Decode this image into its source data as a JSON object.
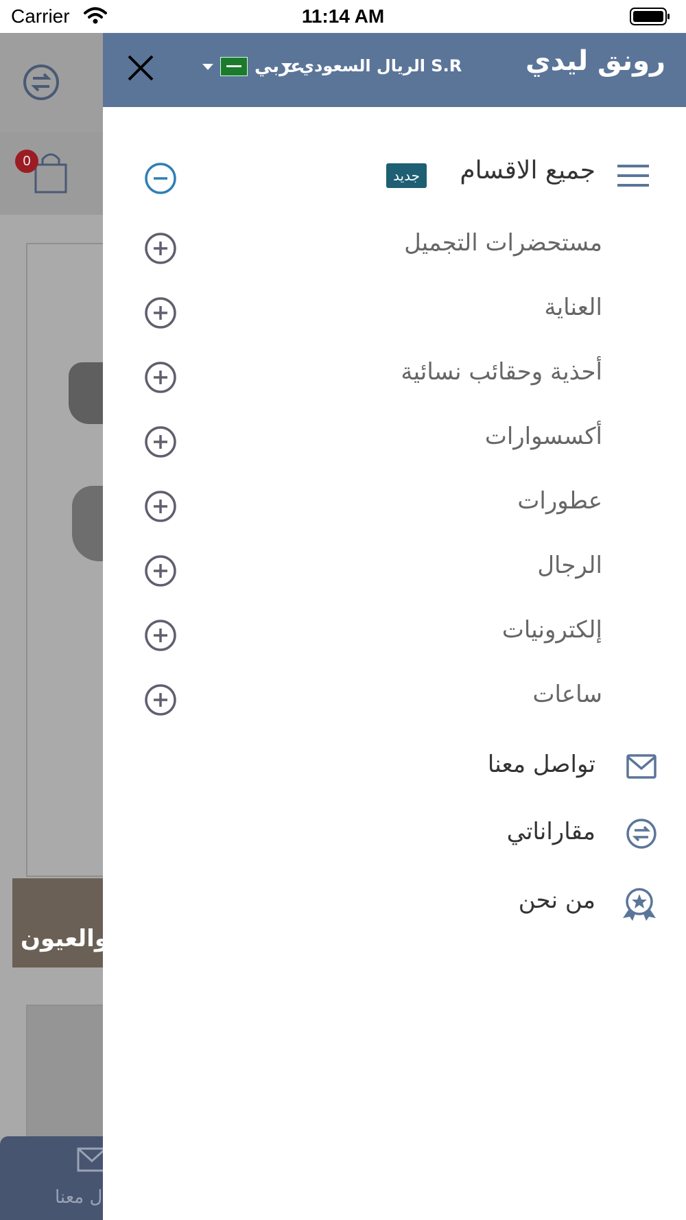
{
  "status_bar": {
    "carrier": "Carrier",
    "time": "11:14 AM"
  },
  "background": {
    "cart_count": "0",
    "banner_text": "والعيون",
    "footer_label": "ل معنا"
  },
  "drawer": {
    "brand": "رونق ليدي",
    "currency": "S.R الريال السعودي",
    "language": "عربي",
    "menu": {
      "all_categories": "جميع الاقسام",
      "new_badge": "جديد",
      "categories": [
        {
          "label": "مستحضرات التجميل"
        },
        {
          "label": "العناية"
        },
        {
          "label": "أحذية وحقائب نسائية"
        },
        {
          "label": "أكسسوارات"
        },
        {
          "label": "عطورات"
        },
        {
          "label": "الرجال"
        },
        {
          "label": "إلكترونيات"
        },
        {
          "label": "ساعات"
        }
      ]
    },
    "links": [
      {
        "label": "تواصل معنا",
        "icon": "mail-icon"
      },
      {
        "label": "مقاراناتي",
        "icon": "compare-icon"
      },
      {
        "label": "من نحن",
        "icon": "about-badge-icon"
      }
    ]
  },
  "colors": {
    "header": "#5b7599",
    "badge_new": "#1e5f74",
    "accent_blue": "#2f7fb7",
    "cart_badge": "#9c1c24"
  }
}
